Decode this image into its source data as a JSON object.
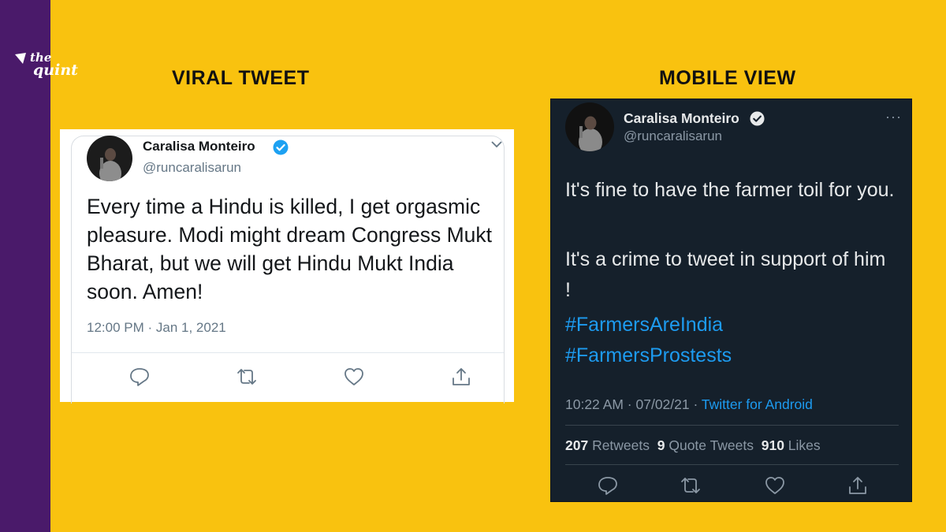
{
  "brand": {
    "logo_text_top": "the",
    "logo_text_bottom": "quint",
    "stripe_color": "#4a1a6a",
    "background_color": "#f9c20f"
  },
  "labels": {
    "viral": "VIRAL TWEET",
    "mobile": "MOBILE VIEW"
  },
  "viral_tweet": {
    "display_name": "Caralisa Monteiro",
    "handle": "@runcaralisarun",
    "text": "Every time a Hindu is killed, I get orgasmic pleasure. Modi might dream Congress Mukt Bharat, but we will get Hindu Mukt India soon. Amen!",
    "timestamp": "12:00 PM · Jan 1, 2021",
    "icons": [
      "avatar",
      "verified-badge-icon",
      "chevron-down-icon",
      "reply-icon",
      "retweet-icon",
      "like-icon",
      "share-icon"
    ]
  },
  "mobile_tweet": {
    "display_name": "Caralisa Monteiro",
    "handle": "@runcaralisarun",
    "paragraph_1": "It's fine to have the farmer toil for you.",
    "paragraph_2": "It's a crime to tweet in support of him !",
    "hashtag_1": "#FarmersAreIndia",
    "hashtag_2": "#FarmersProstests",
    "time_date": "10:22 AM · 07/02/21 · ",
    "source": "Twitter for Android",
    "retweets_count": "207",
    "retweets_label": " Retweets  ",
    "quotes_count": "9",
    "quotes_label": " Quote Tweets  ",
    "likes_count": "910",
    "likes_label": " Likes",
    "more_glyph": "···",
    "accent_color": "#1d9bf0"
  }
}
